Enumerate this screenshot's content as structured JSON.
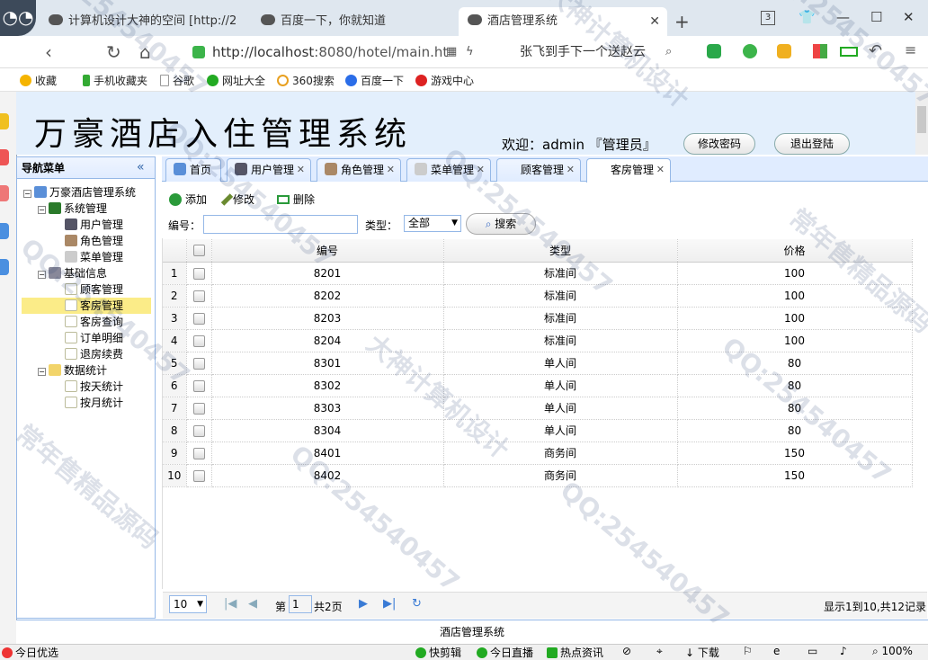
{
  "browser": {
    "tabs": [
      {
        "label": "计算机设计大神的空间 [http://2",
        "active": false
      },
      {
        "label": "百度一下，你就知道",
        "active": false
      },
      {
        "label": "酒店管理系统",
        "active": true
      }
    ],
    "tab_count": "3",
    "url_host": "http://localhost",
    "url_rest": ":8080/hotel/main.ht",
    "search_text": "张飞到手下一个送赵云",
    "bookmarks": [
      "收藏",
      "手机收藏夹",
      "谷歌",
      "网址大全",
      "360搜索",
      "百度一下",
      "游戏中心"
    ],
    "status": {
      "left": "今日优选",
      "items": [
        "快剪辑",
        "今日直播",
        "热点资讯",
        "下载"
      ],
      "zoom": "100%"
    }
  },
  "header": {
    "title": "万豪酒店入住管理系统",
    "welcome": "欢迎：admin 『管理员』",
    "change_password": "修改密码",
    "logout": "退出登陆"
  },
  "nav": {
    "title": "导航菜单",
    "root": "万豪酒店管理系统",
    "groups": [
      {
        "label": "系统管理",
        "items": [
          "用户管理",
          "角色管理",
          "菜单管理"
        ]
      },
      {
        "label": "基础信息",
        "items": [
          "顾客管理",
          "客房管理",
          "客房查询",
          "订单明细",
          "退房续费"
        ]
      },
      {
        "label": "数据统计",
        "items": [
          "按天统计",
          "按月统计"
        ]
      }
    ],
    "selected": "客房管理"
  },
  "tabs": [
    "首页",
    "用户管理",
    "角色管理",
    "菜单管理",
    "顾客管理",
    "客房管理"
  ],
  "toolbar": {
    "add": "添加",
    "edit": "修改",
    "delete": "删除"
  },
  "search": {
    "code_label": "编号：",
    "type_label": "类型：",
    "type_value": "全部",
    "button": "搜索"
  },
  "grid": {
    "columns": [
      "编号",
      "类型",
      "价格"
    ],
    "rows": [
      {
        "n": "1",
        "code": "8201",
        "type": "标准间",
        "price": "100"
      },
      {
        "n": "2",
        "code": "8202",
        "type": "标准间",
        "price": "100"
      },
      {
        "n": "3",
        "code": "8203",
        "type": "标准间",
        "price": "100"
      },
      {
        "n": "4",
        "code": "8204",
        "type": "标准间",
        "price": "100"
      },
      {
        "n": "5",
        "code": "8301",
        "type": "单人间",
        "price": "80"
      },
      {
        "n": "6",
        "code": "8302",
        "type": "单人间",
        "price": "80"
      },
      {
        "n": "7",
        "code": "8303",
        "type": "单人间",
        "price": "80"
      },
      {
        "n": "8",
        "code": "8304",
        "type": "单人间",
        "price": "80"
      },
      {
        "n": "9",
        "code": "8401",
        "type": "商务间",
        "price": "150"
      },
      {
        "n": "10",
        "code": "8402",
        "type": "商务间",
        "price": "150"
      }
    ]
  },
  "pager": {
    "page_size": "10",
    "page_prefix": "第",
    "page_number": "1",
    "page_total": "共2页",
    "summary": "显示1到10,共12记录"
  },
  "footer": "酒店管理系统",
  "watermarks": [
    "QQ:254540457",
    "大神计算机设计",
    "常年售精品源码"
  ]
}
